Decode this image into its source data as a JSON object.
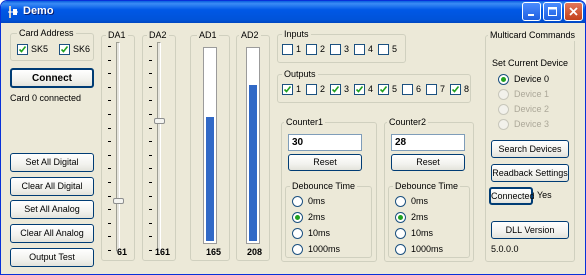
{
  "window": {
    "title": "Demo"
  },
  "card_address": {
    "label": "Card Address",
    "checkboxes": [
      {
        "label": "SK5",
        "checked": true
      },
      {
        "label": "SK6",
        "checked": true
      }
    ]
  },
  "connect": {
    "button_label": "Connect",
    "status": "Card 0 connected"
  },
  "left_buttons": {
    "set_all_digital": "Set All Digital",
    "clear_all_digital": "Clear All Digital",
    "set_all_analog": "Set All Analog",
    "clear_all_analog": "Clear All Analog",
    "output_test": "Output Test"
  },
  "da1": {
    "label": "DA1",
    "value": "61",
    "level": 61
  },
  "da2": {
    "label": "DA2",
    "value": "161",
    "level": 161
  },
  "ad1": {
    "label": "AD1",
    "value": "165",
    "level": 165
  },
  "ad2": {
    "label": "AD2",
    "value": "208",
    "level": 208
  },
  "inputs": {
    "label": "Inputs",
    "items": [
      {
        "label": "1",
        "checked": false
      },
      {
        "label": "2",
        "checked": false
      },
      {
        "label": "3",
        "checked": false
      },
      {
        "label": "4",
        "checked": false
      },
      {
        "label": "5",
        "checked": false
      }
    ]
  },
  "outputs": {
    "label": "Outputs",
    "items": [
      {
        "label": "1",
        "checked": true
      },
      {
        "label": "2",
        "checked": false
      },
      {
        "label": "3",
        "checked": true
      },
      {
        "label": "4",
        "checked": true
      },
      {
        "label": "5",
        "checked": true
      },
      {
        "label": "6",
        "checked": false
      },
      {
        "label": "7",
        "checked": false
      },
      {
        "label": "8",
        "checked": true
      }
    ]
  },
  "counter1": {
    "label": "Counter1",
    "value": "30",
    "reset_label": "Reset",
    "debounce": {
      "label": "Debounce Time",
      "options": [
        "0ms",
        "2ms",
        "10ms",
        "1000ms"
      ],
      "selected": "2ms"
    }
  },
  "counter2": {
    "label": "Counter2",
    "value": "28",
    "reset_label": "Reset",
    "debounce": {
      "label": "Debounce Time",
      "options": [
        "0ms",
        "2ms",
        "10ms",
        "1000ms"
      ],
      "selected": "2ms"
    }
  },
  "multicard": {
    "label": "Multicard Commands",
    "set_current_device": "Set Current Device",
    "devices": [
      {
        "label": "Device 0",
        "selected": true,
        "enabled": true
      },
      {
        "label": "Device 1",
        "selected": false,
        "enabled": false
      },
      {
        "label": "Device 2",
        "selected": false,
        "enabled": false
      },
      {
        "label": "Device 3",
        "selected": false,
        "enabled": false
      }
    ],
    "search_devices": "Search Devices",
    "readback_settings": "Readback Settings",
    "connected_button": "Connected",
    "connected_value": "Yes",
    "dll_version_button": "DLL Version",
    "dll_version_value": "5.0.0.0"
  },
  "colors": {
    "title_bar": "#0054e3",
    "progress_fill": "#3169c6",
    "window_face": "#ece9d8"
  }
}
